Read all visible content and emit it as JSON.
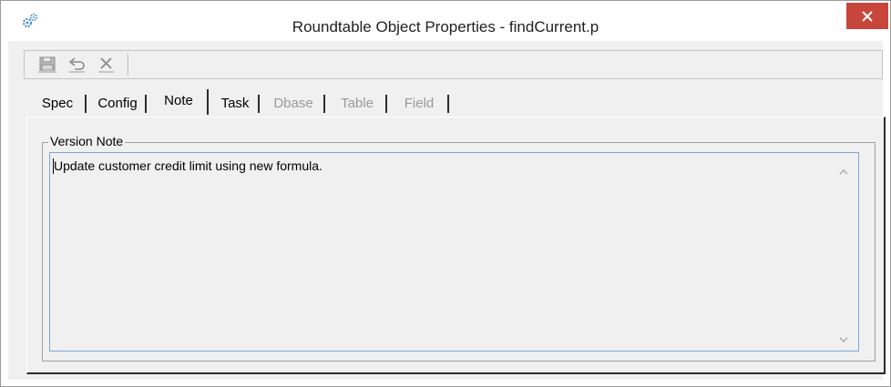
{
  "window": {
    "title": "Roundtable Object Properties - findCurrent.p",
    "icon": "gears-icon",
    "close_icon": "close-icon"
  },
  "toolbar": {
    "buttons": [
      {
        "name": "save-icon"
      },
      {
        "name": "undo-icon"
      },
      {
        "name": "delete-icon"
      }
    ]
  },
  "tabs": [
    {
      "label": "Spec",
      "state": "normal"
    },
    {
      "label": "Config",
      "state": "normal"
    },
    {
      "label": "Note",
      "state": "active"
    },
    {
      "label": "Task",
      "state": "normal"
    },
    {
      "label": "Dbase",
      "state": "disabled"
    },
    {
      "label": "Table",
      "state": "disabled"
    },
    {
      "label": "Field",
      "state": "disabled"
    }
  ],
  "note": {
    "group_label": "Version Note",
    "text": "Update customer credit limit using new formula."
  },
  "colors": {
    "close_button": "#c7463c",
    "editor_border": "#7aa7d9",
    "background": "#f0f0f0"
  }
}
